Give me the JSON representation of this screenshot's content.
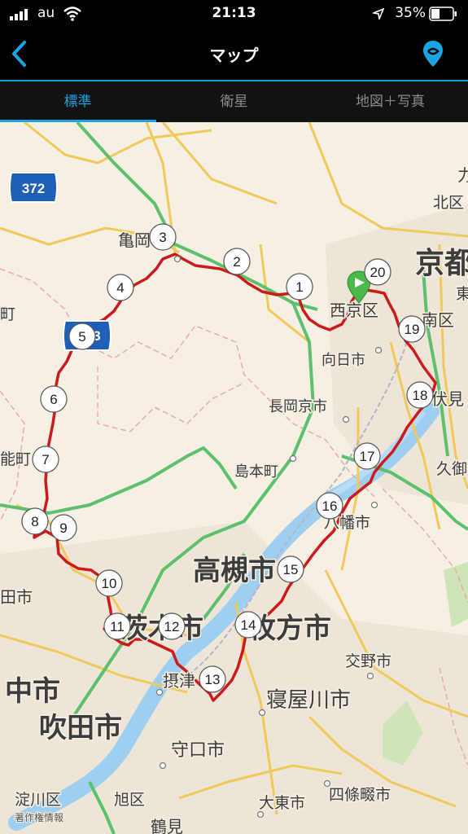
{
  "status_bar": {
    "carrier": "au",
    "time": "21:13",
    "battery": "35%"
  },
  "nav": {
    "title": "マップ"
  },
  "tabs": [
    {
      "label": "標準"
    },
    {
      "label": "衛星"
    },
    {
      "label": "地図＋写真"
    }
  ],
  "map": {
    "route_color": "#cc1a1a",
    "route_shield": "372",
    "route_shield_2": "3",
    "copyright": "著作権情報",
    "place_labels": [
      "亀岡",
      "北区",
      "京都",
      "西京区",
      "東",
      "南区",
      "向日市",
      "伏見",
      "長岡京市",
      "久御",
      "島本町",
      "八幡市",
      "高槻市",
      "茨木市",
      "枚方市",
      "交野市",
      "摂津",
      "寝屋川市",
      "中市",
      "吹田市",
      "守口市",
      "淀川区",
      "旭区",
      "大東市",
      "四條畷市",
      "鶴見",
      "能町",
      "町",
      "田市",
      "力"
    ],
    "waypoints": [
      "1",
      "2",
      "3",
      "4",
      "5",
      "6",
      "7",
      "8",
      "9",
      "10",
      "11",
      "12",
      "13",
      "14",
      "15",
      "16",
      "17",
      "18",
      "19",
      "20"
    ]
  }
}
